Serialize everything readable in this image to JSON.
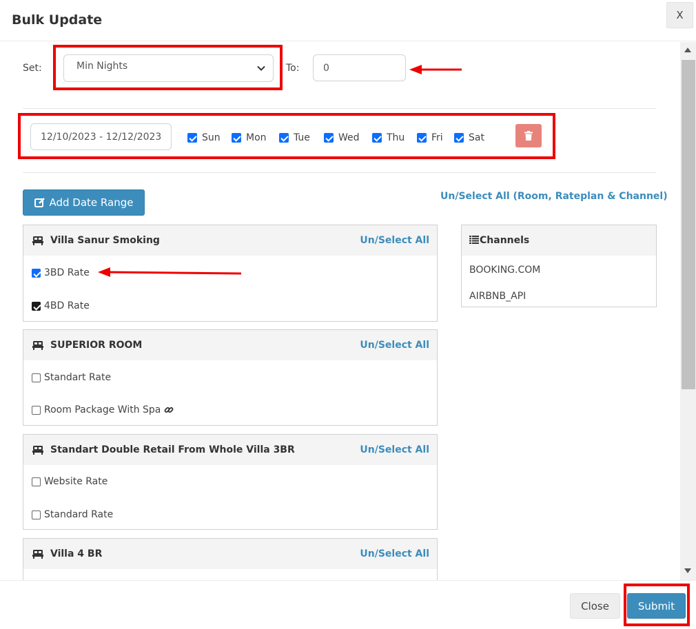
{
  "modal": {
    "title": "Bulk Update",
    "close_x": "X"
  },
  "form": {
    "set_label": "Set:",
    "set_value": "Min Nights",
    "to_label": "To:",
    "to_value": "0",
    "date_range": "12/10/2023 - 12/12/2023",
    "days": [
      {
        "label": "Sun",
        "checked": true
      },
      {
        "label": "Mon",
        "checked": true
      },
      {
        "label": "Tue",
        "checked": true
      },
      {
        "label": "Wed",
        "checked": true
      },
      {
        "label": "Thu",
        "checked": true
      },
      {
        "label": "Fri",
        "checked": true
      },
      {
        "label": "Sat",
        "checked": true
      }
    ],
    "add_range_label": "Add Date Range",
    "select_all_global": "Un/Select All (Room, Rateplan & Channel)"
  },
  "rooms": [
    {
      "name": "Villa Sanur Smoking",
      "select_all": "Un/Select All",
      "rates": [
        {
          "label": "3BD Rate",
          "checked": true
        },
        {
          "label": "4BD Rate",
          "checked": true
        }
      ]
    },
    {
      "name": "SUPERIOR ROOM",
      "select_all": "Un/Select All",
      "rates": [
        {
          "label": "Standart Rate",
          "checked": false
        },
        {
          "label": "Room Package With Spa",
          "checked": false
        }
      ]
    },
    {
      "name": "Standart Double Retail From Whole Villa 3BR",
      "select_all": "Un/Select All",
      "rates": [
        {
          "label": "Website Rate",
          "checked": false
        },
        {
          "label": "Standard Rate",
          "checked": false
        }
      ]
    },
    {
      "name": "Villa 4 BR",
      "select_all": "Un/Select All",
      "rates": []
    }
  ],
  "channels": {
    "title": "Channels",
    "items": [
      "BOOKING.COM",
      "AIRBNB_API"
    ]
  },
  "footer": {
    "close_label": "Close",
    "submit_label": "Submit"
  },
  "colors": {
    "primary": "#3c8dbc",
    "danger": "#e8837b",
    "annotation": "#ee0000",
    "checkbox": "#0d6efd"
  }
}
